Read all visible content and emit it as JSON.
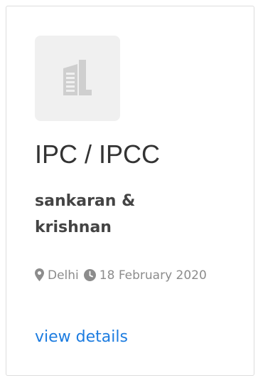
{
  "card": {
    "title": "IPC / IPCC",
    "company": "sankaran & krishnan",
    "location": "Delhi",
    "date": "18 February 2020",
    "link_label": "view details",
    "icons": {
      "logo": "building-icon",
      "location": "map-marker-icon",
      "date": "clock-icon"
    },
    "colors": {
      "link": "#1c7ce0",
      "meta": "#8c8c8c",
      "title": "#333333",
      "company": "#444444",
      "logo_background": "#f0f0f0",
      "border": "#dddddd"
    }
  }
}
